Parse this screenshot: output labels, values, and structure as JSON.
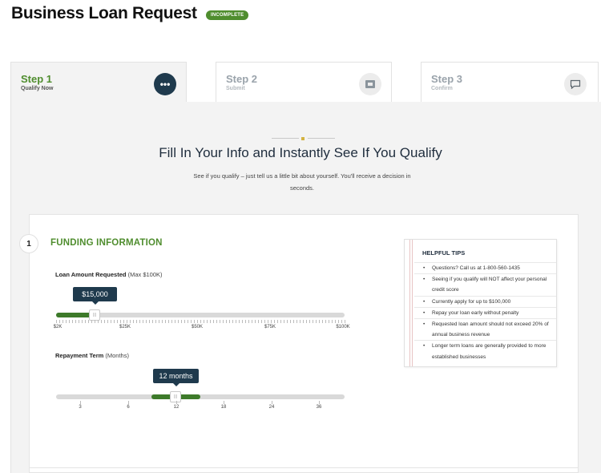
{
  "header": {
    "title": "Business Loan Request",
    "badge": "INCOMPLETE"
  },
  "steps": [
    {
      "name": "Step 1",
      "sub": "Qualify Now",
      "icon": "more-dots-icon",
      "active": true
    },
    {
      "name": "Step 2",
      "sub": "Submit",
      "icon": "document-icon",
      "active": false
    },
    {
      "name": "Step 3",
      "sub": "Confirm",
      "icon": "chat-icon",
      "active": false
    }
  ],
  "intro": {
    "heading": "Fill In Your Info and Instantly See If You Qualify",
    "text": "See if you qualify – just tell us a little bit about yourself. You'll receive a decision in seconds."
  },
  "section": {
    "number": "1",
    "title": "FUNDING INFORMATION"
  },
  "loan": {
    "label": "Loan Amount Requested",
    "hint": "(Max $100K)",
    "value_text": "$15,000",
    "value": 15000,
    "min": 2000,
    "max": 100000,
    "ticks": [
      "$2K",
      "$25K",
      "$50K",
      "$75K",
      "$100K"
    ]
  },
  "term": {
    "label": "Repayment Term",
    "hint": "(Months)",
    "value_text": "12 months",
    "value": 12,
    "ticks": [
      "3",
      "6",
      "12",
      "18",
      "24",
      "36"
    ]
  },
  "tips": {
    "title": "HELPFUL TIPS",
    "items": [
      "Questions? Call us at 1-800-560-1435",
      "Seeing if you qualify will NOT affect your personal credit score",
      "Currently apply for up to $100,000",
      "Repay your loan early without penalty",
      "Requested loan amount should not exceed 20% of annual business revenue",
      "Longer term loans are generally provided to more established businesses"
    ]
  },
  "colors": {
    "accent_green": "#4f8d2e",
    "navy": "#1f3a4d"
  }
}
